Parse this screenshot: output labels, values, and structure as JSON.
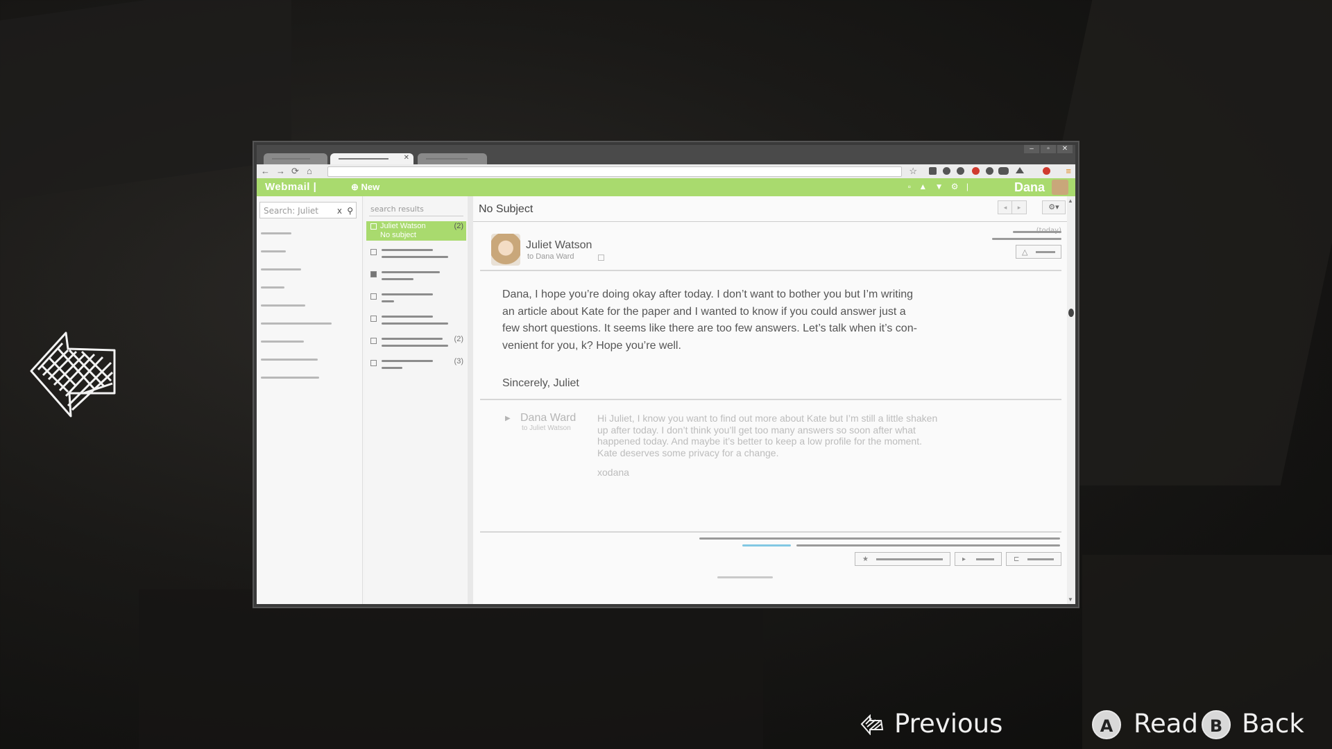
{
  "browser": {
    "window_controls": [
      "–",
      "▫",
      "✕"
    ],
    "nav": {
      "back": "←",
      "forward": "→",
      "reload": "⟳",
      "home": "⌂"
    },
    "star": "☆",
    "menu": "≡"
  },
  "app": {
    "brand": "Webmail |",
    "new_label": "⊕ New",
    "user_name": "Dana",
    "toolbar_icons": "▫ ▲ ▼ ⚙ |"
  },
  "leftnav": {
    "search_placeholder": "Search: Juliet",
    "clear_glyph": "x",
    "search_glyph": "⚲"
  },
  "message_list": {
    "header": "search results",
    "selected": {
      "sender": "Juliet Watson",
      "subject": "No subject",
      "count": "(2)"
    },
    "row_counts": [
      "(2)",
      "(3)"
    ]
  },
  "reader": {
    "subject": "No Subject",
    "pager_prev": "◂",
    "pager_next": "▸",
    "settings_glyph": "⚙▾",
    "sender": "Juliet Watson",
    "to": "to Dana Ward",
    "date": "(today)",
    "reply_glyph": "△",
    "body": [
      "Dana, I hope you’re doing okay after today. I don’t want to bother you but I’m writing",
      "an article about Kate for the paper and I wanted to know if you could answer just a",
      "few short questions. It seems like there are too few answers. Let’s talk when it’s con-",
      "venient for you, k? Hope you’re well."
    ],
    "signature": "Sincerely, Juliet",
    "quoted": {
      "sender": "Dana Ward",
      "to": "to Juliet Watson",
      "body": [
        "Hi Juliet, I know you want to find out more about Kate but I’m still a little shaken",
        "up after today. I don’t think you’ll get too many answers so soon after what",
        "happened today. And maybe it’s better to keep a low profile for the moment.",
        "Kate deserves some privacy for a change."
      ],
      "signoff": "xodana"
    },
    "footer_buttons": [
      "★",
      "▸",
      "⊏"
    ]
  },
  "prompts": {
    "previous": "Previous",
    "read": "Read",
    "back": "Back",
    "a_glyph": "A",
    "b_glyph": "B"
  }
}
